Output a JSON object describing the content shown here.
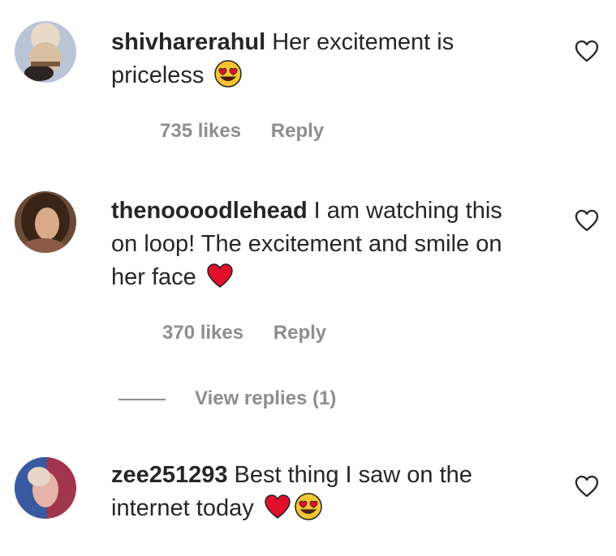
{
  "comments": [
    {
      "username": "shivharerahul",
      "text": "Her excitement is priceless",
      "emojis": [
        "heart-eyes"
      ],
      "likes": "735 likes",
      "reply_label": "Reply"
    },
    {
      "username": "thenoooodlehead",
      "text": "I am watching this on loop! The excitement and smile on her face",
      "emojis": [
        "red-heart"
      ],
      "likes": "370 likes",
      "reply_label": "Reply",
      "view_replies": "View replies (1)"
    },
    {
      "username": "zee251293",
      "text": "Best thing I saw on the internet today",
      "emojis": [
        "red-heart",
        "heart-eyes"
      ]
    }
  ],
  "colors": {
    "text": "#262626",
    "meta": "#8e8e8e",
    "heart": "#e0102c",
    "emoji_face": "#f7c531"
  }
}
